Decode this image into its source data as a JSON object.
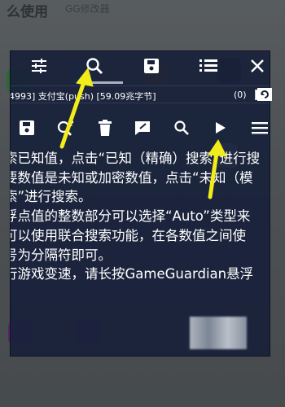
{
  "background": {
    "title": "么使用",
    "subtitle": "GG修改器",
    "app_icons": [
      "wechat-icon",
      "game-icon",
      "map-icon",
      "tc-games-icon",
      "qq-icon"
    ],
    "colors": {
      "accent": "#e5c700"
    }
  },
  "toolbar": {
    "icons": [
      "settings-sliders-icon",
      "search-icon",
      "save-icon",
      "list-icon",
      "close-icon"
    ],
    "active_tab": "search"
  },
  "process": {
    "text": "4993] 支付宝(push) [59.09兆字节]",
    "count": "(0)"
  },
  "search_toolbar": {
    "icons": [
      "save-icon",
      "unknown-search-icon",
      "delete-icon",
      "edit-icon",
      "search-icon",
      "play-icon",
      "menu-icon"
    ]
  },
  "help": {
    "lines": [
      "索已知值，点击“已知（精确）搜索”进行搜",
      "要数值是未知或加密数值，点击“未知（模",
      "索”进行搜索。",
      "浮点值的整数部分可以选择“Auto”类型来",
      "可以使用联合搜索功能，在各数值之间使",
      "号为分隔符即可。",
      "行游戏变速，请长按GameGuardian悬浮"
    ]
  },
  "annotations": {
    "arrow_color": "#f2ec1a"
  }
}
